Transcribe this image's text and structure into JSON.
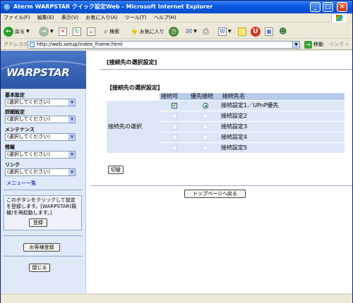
{
  "window": {
    "title": "Aterm WARPSTAR クイック設定Web - Microsoft Internet Explorer"
  },
  "menu": {
    "items": [
      "ファイル(F)",
      "編集(E)",
      "表示(V)",
      "お気に入り(A)",
      "ツール(T)",
      "ヘルプ(H)"
    ]
  },
  "toolbar": {
    "back_label": "戻る",
    "search_label": "検索",
    "favorites_label": "お気に入り"
  },
  "address": {
    "label": "アドレス(D)",
    "url": "http://web.setup/index_frame.html",
    "go_label": "移動",
    "links_label": "リンク »"
  },
  "sidebar": {
    "logo": "WARPSTAR",
    "groups": [
      {
        "label": "基本設定",
        "selected": "(選択してください)"
      },
      {
        "label": "詳細設定",
        "selected": "(選択してください)"
      },
      {
        "label": "メンテナンス",
        "selected": "(選択してください)"
      },
      {
        "label": "情報",
        "selected": "(選択してください)"
      },
      {
        "label": "リンク",
        "selected": "(選択してください)"
      }
    ],
    "menu_list_link": "メニュー一覧",
    "note": "このボタンをクリックして設定を登録します。[WARPSTAR(親機)を再起動します。]",
    "register_label": "登録",
    "customer_register_label": "お客様登録",
    "close_label": "閉じる"
  },
  "main": {
    "page_title": "[接続先の選択設定]",
    "section_title": "【接続先の選択設定】",
    "table": {
      "headers": [
        "接続可",
        "優先接続",
        "接続先名"
      ],
      "row_header": "接続先の選択",
      "rows": [
        {
          "enabled": true,
          "priority": true,
          "name": "接続設定1／UPnP優先",
          "active": true
        },
        {
          "enabled": false,
          "priority": false,
          "name": "接続設定2",
          "active": false
        },
        {
          "enabled": false,
          "priority": false,
          "name": "接続設定3",
          "active": false
        },
        {
          "enabled": false,
          "priority": false,
          "name": "接続設定4",
          "active": false
        },
        {
          "enabled": false,
          "priority": false,
          "name": "接続設定5",
          "active": false
        }
      ]
    },
    "switch_label": "切替",
    "top_page_label": "トップページへ戻る"
  }
}
